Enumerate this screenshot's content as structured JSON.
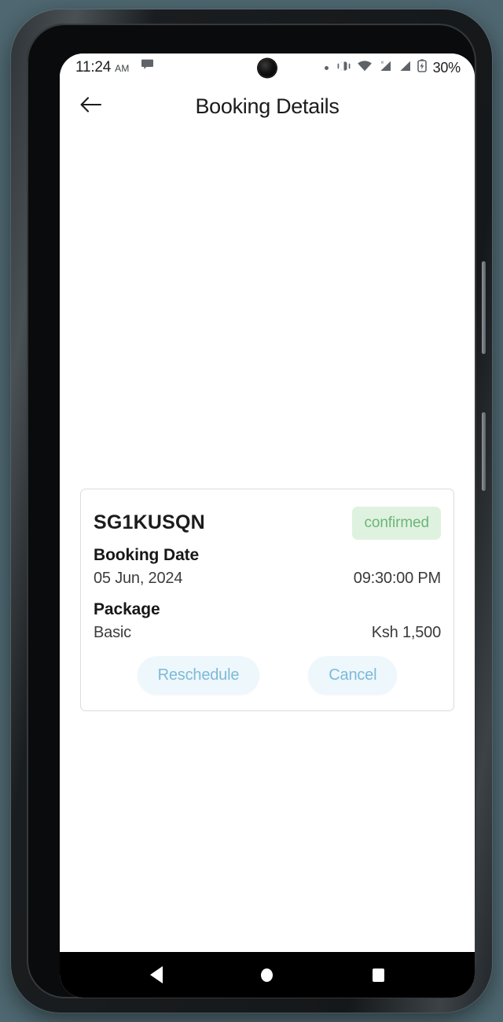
{
  "status_bar": {
    "time": "11:24",
    "ampm": "AM",
    "notification_icon": "chat-bubble-icon",
    "icons": [
      "dot-icon",
      "vibrate-icon",
      "wifi-icon",
      "signal-icon-1",
      "signal-icon-2",
      "battery-charging-icon"
    ],
    "battery_percent": "30%"
  },
  "app_bar": {
    "back_icon": "arrow-left-icon",
    "title": "Booking Details"
  },
  "booking_card": {
    "code": "SG1KUSQN",
    "status": "confirmed",
    "status_bg_color": "#dff2e0",
    "status_text_color": "#6cb579",
    "date_label": "Booking Date",
    "date_value": "05 Jun, 2024",
    "time_value": "09:30:00 PM",
    "package_label": "Package",
    "package_value": "Basic",
    "price_value": "Ksh 1,500",
    "reschedule_label": "Reschedule",
    "cancel_label": "Cancel",
    "button_bg_color": "#eef7fc",
    "button_text_color": "#7cbad8"
  },
  "nav_bar": {
    "back": "nav-back-icon",
    "home": "nav-home-icon",
    "recents": "nav-recents-icon"
  }
}
